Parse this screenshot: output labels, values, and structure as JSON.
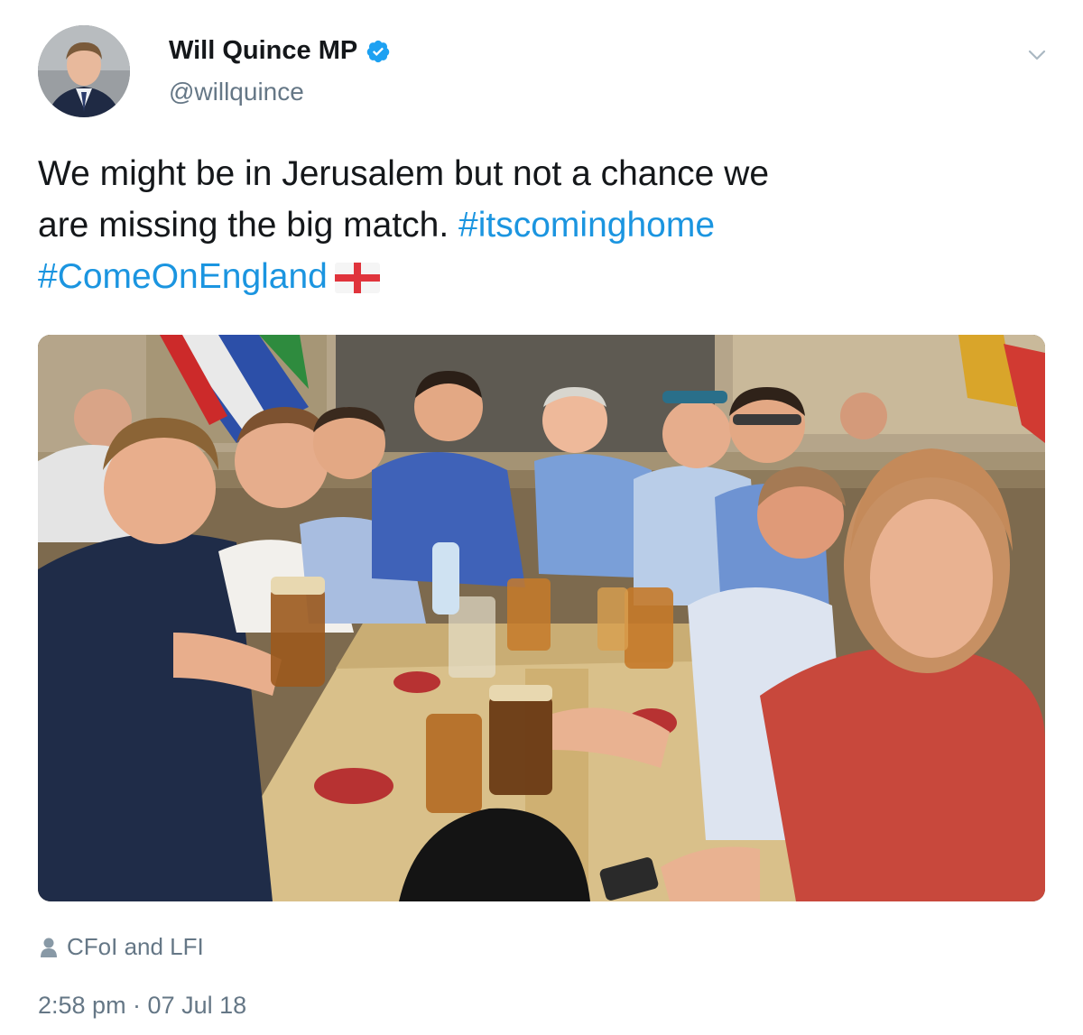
{
  "tweet": {
    "author": {
      "name": "Will Quince MP",
      "handle": "@willquince",
      "verified": true
    },
    "text": {
      "plain_line1": "We might be in Jerusalem but not a chance we",
      "plain_line2": "are missing the big match.",
      "hashtag1": "#itscominghome",
      "hashtag2": "#ComeOnEngland",
      "emoji": "england-flag"
    },
    "tagged_people": "CFoI and LFI",
    "timestamp": "2:58 pm · 07 Jul 18"
  },
  "colors": {
    "text": "#14171a",
    "secondary": "#657786",
    "link": "#1b95e0",
    "verified_badge": "#1da1f2",
    "flag_red": "#e0343c"
  },
  "icons": [
    "verified-badge-icon",
    "chevron-down-icon",
    "person-icon",
    "england-flag-icon"
  ]
}
